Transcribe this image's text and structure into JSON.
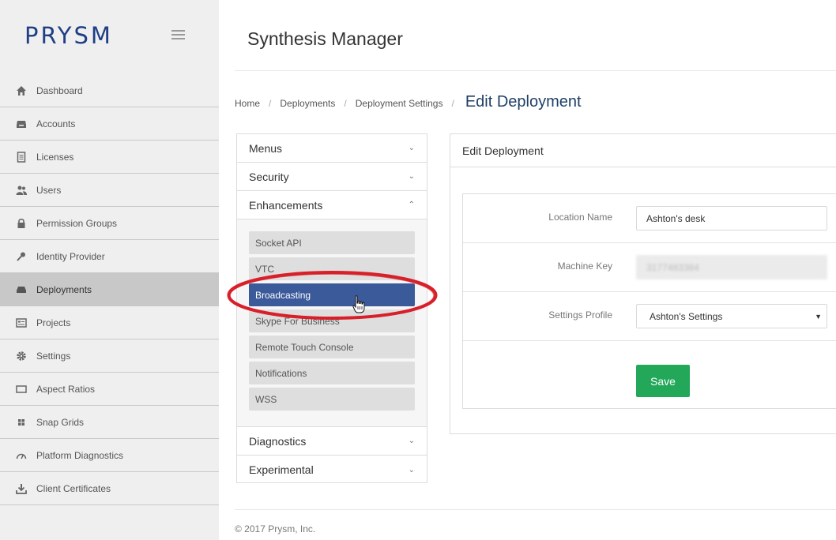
{
  "brand": {
    "logo_text": "PRYSM"
  },
  "header": {
    "title": "Synthesis Manager"
  },
  "sidebar": {
    "items": [
      {
        "label": "Dashboard",
        "icon": "home-icon",
        "active": false
      },
      {
        "label": "Accounts",
        "icon": "inbox-icon",
        "active": false
      },
      {
        "label": "Licenses",
        "icon": "document-icon",
        "active": false
      },
      {
        "label": "Users",
        "icon": "users-icon",
        "active": false
      },
      {
        "label": "Permission Groups",
        "icon": "lock-icon",
        "active": false
      },
      {
        "label": "Identity Provider",
        "icon": "key-icon",
        "active": false
      },
      {
        "label": "Deployments",
        "icon": "drive-icon",
        "active": true
      },
      {
        "label": "Projects",
        "icon": "projects-icon",
        "active": false
      },
      {
        "label": "Settings",
        "icon": "gear-icon",
        "active": false
      },
      {
        "label": "Aspect Ratios",
        "icon": "aspect-ratio-icon",
        "active": false
      },
      {
        "label": "Snap Grids",
        "icon": "grid-icon",
        "active": false
      },
      {
        "label": "Platform Diagnostics",
        "icon": "dashboard-gauge-icon",
        "active": false
      },
      {
        "label": "Client Certificates",
        "icon": "download-icon",
        "active": false
      }
    ]
  },
  "breadcrumb": {
    "items": [
      "Home",
      "Deployments",
      "Deployment Settings"
    ],
    "separator": "/",
    "current": "Edit Deployment"
  },
  "accordion": {
    "sections": [
      {
        "label": "Menus",
        "expanded": false
      },
      {
        "label": "Security",
        "expanded": false
      },
      {
        "label": "Enhancements",
        "expanded": true
      },
      {
        "label": "Diagnostics",
        "expanded": false
      },
      {
        "label": "Experimental",
        "expanded": false
      }
    ],
    "enhancements_items": [
      {
        "label": "Socket API",
        "selected": false
      },
      {
        "label": "VTC",
        "selected": false
      },
      {
        "label": "Broadcasting",
        "selected": true
      },
      {
        "label": "Skype For Business",
        "selected": false
      },
      {
        "label": "Remote Touch Console",
        "selected": false
      },
      {
        "label": "Notifications",
        "selected": false
      },
      {
        "label": "WSS",
        "selected": false
      }
    ]
  },
  "edit_panel": {
    "title": "Edit Deployment",
    "fields": {
      "location_name": {
        "label": "Location Name",
        "value": "Ashton's desk"
      },
      "machine_key": {
        "label": "Machine Key",
        "value": "3177483384"
      },
      "settings_profile": {
        "label": "Settings Profile",
        "value": "Ashton's Settings"
      }
    },
    "save_label": "Save"
  },
  "footer": {
    "text": "© 2017 Prysm, Inc."
  },
  "colors": {
    "brand_blue": "#1e3f84",
    "selected_item": "#3b5a9a",
    "save_green": "#23a85a",
    "annotation_red": "#d8202a",
    "sidebar_bg": "#efefef",
    "sidebar_active": "#c8c8c8"
  }
}
